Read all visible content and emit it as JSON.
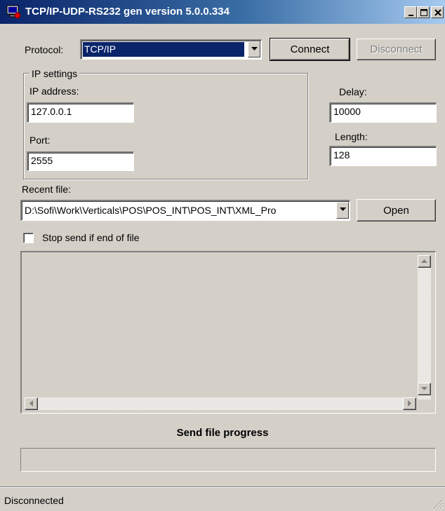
{
  "window": {
    "title": "TCP/IP-UDP-RS232 gen version 5.0.0.334"
  },
  "protocol": {
    "label": "Protocol:",
    "selected": "TCP/IP",
    "connect_label": "Connect",
    "disconnect_label": "Disconnect"
  },
  "ip_settings": {
    "group_title": "IP settings",
    "ip_label": "IP address:",
    "ip_value": "127.0.0.1",
    "port_label": "Port:",
    "port_value": "2555"
  },
  "delay": {
    "label": "Delay:",
    "value": "10000"
  },
  "length": {
    "label": "Length:",
    "value": "128"
  },
  "recent_file": {
    "label": "Recent file:",
    "value": "D:\\Sofi\\Work\\Verticals\\POS\\POS_INT\\POS_INT\\XML_Pro",
    "open_label": "Open"
  },
  "stop_send": {
    "label": "Stop send if end of file",
    "checked": false
  },
  "progress": {
    "title": "Send file progress",
    "percent": 0
  },
  "status": {
    "text": "Disconnected"
  },
  "colors": {
    "face": "#d4d0c8",
    "title_start": "#0a246a",
    "title_end": "#a6caf0",
    "selection": "#0a246a"
  },
  "icons": [
    "computer-network-icon",
    "minimize-icon",
    "maximize-icon",
    "close-icon",
    "dropdown-arrow-icon",
    "scroll-up-icon",
    "scroll-down-icon",
    "scroll-left-icon",
    "scroll-right-icon",
    "size-grip-icon"
  ]
}
